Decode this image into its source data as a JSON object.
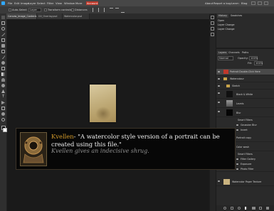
{
  "menubar": {
    "items": [
      "File",
      "Edit",
      "Image",
      "Layer",
      "Select",
      "Filter",
      "View",
      "Window",
      "More"
    ],
    "account": "Account",
    "right_items": [
      "About",
      "Report a bug",
      "Learn",
      "Blog"
    ]
  },
  "options": {
    "auto_select": "Auto-Select",
    "layer_select": "Layer",
    "transform_controls": "Transform controls",
    "distances": "Distances"
  },
  "tabs": [
    {
      "label": "Canvas_Image_Content.psd"
    },
    {
      "label": "UV_Overlay.psd"
    },
    {
      "label": "Watercolor.psd"
    }
  ],
  "history": {
    "tabs": [
      "History",
      "Swatches"
    ],
    "items": [
      "Open",
      "Layer Change",
      "Layer Change"
    ]
  },
  "layers": {
    "tabs": [
      "Layers",
      "Channels",
      "Paths"
    ],
    "blend_mode": "Normal",
    "opacity_label": "Opacity:",
    "opacity_value": "100%",
    "fill_label": "Fill:",
    "fill_value": "100%",
    "rows": [
      {
        "name": "Portrait Double-Click Here"
      },
      {
        "name": "Watercolour"
      },
      {
        "name": "Sketch"
      },
      {
        "name": "Black & White"
      },
      {
        "name": "Levels"
      },
      {
        "name": "Blur"
      },
      {
        "name": "Smart Filters"
      },
      {
        "name": "Gaussian Blur"
      },
      {
        "name": "Invert"
      },
      {
        "name": "Portrait copy"
      },
      {
        "name": "Color wash"
      },
      {
        "name": "Smart Filters"
      },
      {
        "name": "Filter Gallery"
      },
      {
        "name": "Exposure"
      },
      {
        "name": "Photo Filter"
      },
      {
        "name": "Watercolor Paper Texture"
      }
    ]
  },
  "dialog": {
    "speaker": "Kvellen",
    "quote": "- \"A watercolor style version of a portrait can be created using this file.\"",
    "narration": "Kvellen gives an indecisive shrug."
  },
  "colors": {
    "accent_menu": "#c0392b",
    "speaker": "#d39a2a",
    "narration": "#8f8f8f",
    "highlight_layer": "#4a4a4a"
  }
}
